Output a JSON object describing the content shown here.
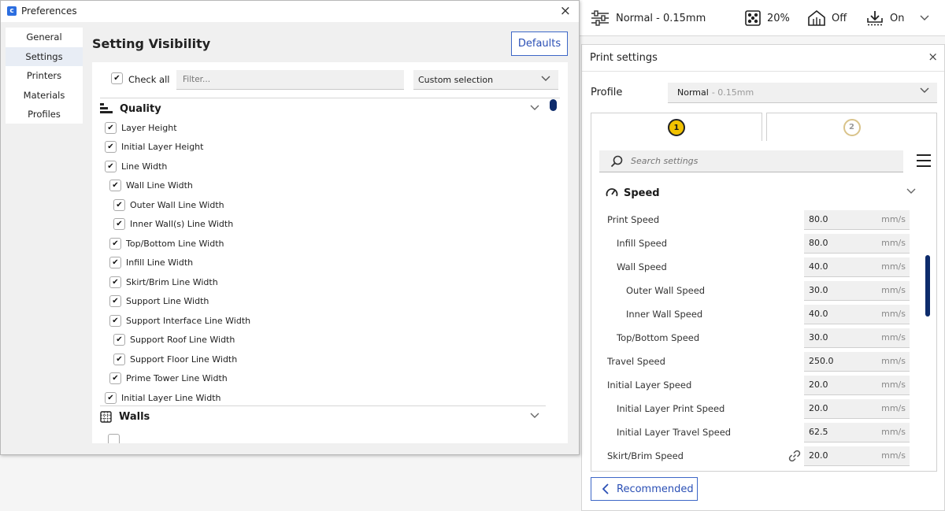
{
  "topbar": {
    "profile": "Normal - 0.15mm",
    "infill": "20%",
    "support": "Off",
    "adhesion": "On"
  },
  "print_settings": {
    "title": "Print settings",
    "close": "×",
    "profile_label": "Profile",
    "profile_value": "Normal",
    "profile_sub": "- 0.15mm",
    "tabs": [
      {
        "label": "1"
      },
      {
        "label": "2"
      }
    ],
    "search_placeholder": "Search settings",
    "category": "Speed",
    "rows": [
      {
        "label": "Print Speed",
        "value": "80.0",
        "unit": "mm/s"
      },
      {
        "label": "Infill Speed",
        "value": "80.0",
        "unit": "mm/s"
      },
      {
        "label": "Wall Speed",
        "value": "40.0",
        "unit": "mm/s"
      },
      {
        "label": "Outer Wall Speed",
        "value": "30.0",
        "unit": "mm/s"
      },
      {
        "label": "Inner Wall Speed",
        "value": "40.0",
        "unit": "mm/s"
      },
      {
        "label": "Top/Bottom Speed",
        "value": "30.0",
        "unit": "mm/s"
      },
      {
        "label": "Travel Speed",
        "value": "250.0",
        "unit": "mm/s"
      },
      {
        "label": "Initial Layer Speed",
        "value": "20.0",
        "unit": "mm/s"
      },
      {
        "label": "Initial Layer Print Speed",
        "value": "20.0",
        "unit": "mm/s"
      },
      {
        "label": "Initial Layer Travel Speed",
        "value": "62.5",
        "unit": "mm/s"
      },
      {
        "label": "Skirt/Brim Speed",
        "value": "20.0",
        "unit": "mm/s"
      }
    ],
    "recommended": "Recommended"
  },
  "preferences": {
    "title": "Preferences",
    "close": "×",
    "nav": [
      {
        "label": "General"
      },
      {
        "label": "Settings"
      },
      {
        "label": "Printers"
      },
      {
        "label": "Materials"
      },
      {
        "label": "Profiles"
      }
    ],
    "section_title": "Setting Visibility",
    "defaults": "Defaults",
    "check_all": "Check all",
    "filter_placeholder": "Filter...",
    "selection": "Custom selection",
    "quality": "Quality",
    "walls": "Walls",
    "items": [
      {
        "label": "Layer Height"
      },
      {
        "label": "Initial Layer Height"
      },
      {
        "label": "Line Width"
      },
      {
        "label": "Wall Line Width"
      },
      {
        "label": "Outer Wall Line Width"
      },
      {
        "label": "Inner Wall(s) Line Width"
      },
      {
        "label": "Top/Bottom Line Width"
      },
      {
        "label": "Infill Line Width"
      },
      {
        "label": "Skirt/Brim Line Width"
      },
      {
        "label": "Support Line Width"
      },
      {
        "label": "Support Interface Line Width"
      },
      {
        "label": "Support Roof Line Width"
      },
      {
        "label": "Support Floor Line Width"
      },
      {
        "label": "Prime Tower Line Width"
      },
      {
        "label": "Initial Layer Line Width"
      }
    ]
  },
  "colors": {
    "accent": "#2a4fb5",
    "scroll": "#0d2b6b",
    "badge_active": "#f2c200",
    "badge_inactive": "#d9c38a"
  }
}
